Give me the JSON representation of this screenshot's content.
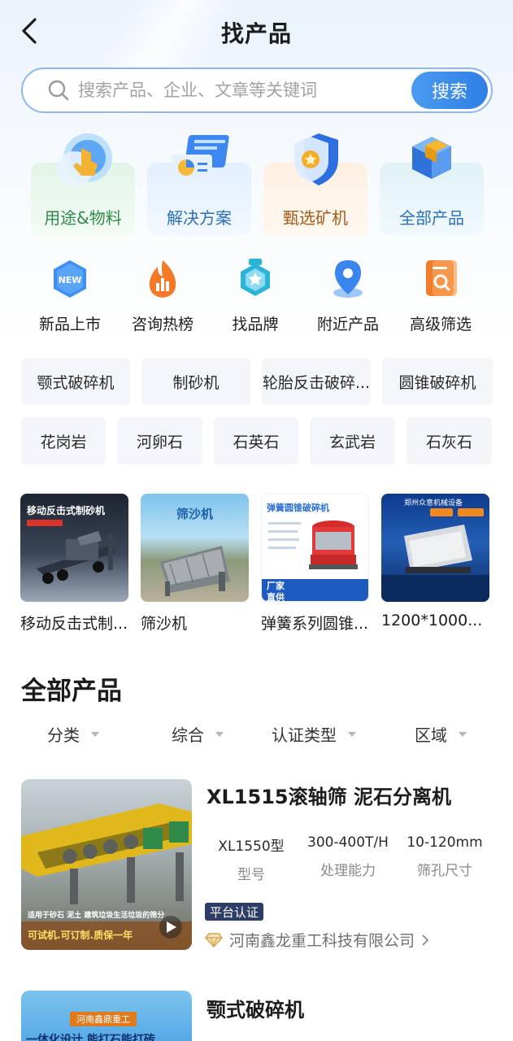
{
  "header": {
    "title": "找产品"
  },
  "search": {
    "placeholder": "搜索产品、企业、文章等关键词",
    "button": "搜索"
  },
  "categories": [
    {
      "label": "用途&物料",
      "color": "#2f8a4a"
    },
    {
      "label": "解决方案",
      "color": "#2d6fb5"
    },
    {
      "label": "甄选矿机",
      "color": "#a35a16"
    },
    {
      "label": "全部产品",
      "color": "#2a6fb8"
    }
  ],
  "quick_links": [
    {
      "label": "新品上市",
      "icon": "new-icon"
    },
    {
      "label": "咨询热榜",
      "icon": "hot-chart-icon"
    },
    {
      "label": "找品牌",
      "icon": "brand-star-icon"
    },
    {
      "label": "附近产品",
      "icon": "location-pin-icon"
    },
    {
      "label": "高级筛选",
      "icon": "filter-search-icon"
    }
  ],
  "chips_row1": [
    "颚式破碎机",
    "制砂机",
    "轮胎反击破碎...",
    "圆锥破碎机"
  ],
  "chips_row2": [
    "花岗岩",
    "河卵石",
    "石英石",
    "玄武岩",
    "石灰石"
  ],
  "featured": [
    {
      "caption": "移动反击式制...",
      "banner": "移动反击式制砂机"
    },
    {
      "caption": "筛沙机",
      "banner": "筛沙机"
    },
    {
      "caption": "弹簧系列圆锥...",
      "banner": "弹簧圆锥破碎机",
      "tag1": "厂家",
      "tag2": "直供"
    },
    {
      "caption": "1200*1000...",
      "banner": "郑州众意机械设备"
    }
  ],
  "section": {
    "title": "全部产品"
  },
  "filters": [
    "分类",
    "综合",
    "认证类型",
    "区域"
  ],
  "product1": {
    "name": "XL1515滚轴筛 泥石分离机",
    "specs": [
      {
        "value": "XL1550型",
        "label": "型号"
      },
      {
        "value": "300-400T/H",
        "label": "处理能力"
      },
      {
        "value": "10-120mm",
        "label": "筛孔尺寸"
      }
    ],
    "badge": "平台认证",
    "company": "河南鑫龙重工科技有限公司",
    "image_text1": "适用于砂石 泥土 建筑垃圾生活垃圾的筛分",
    "image_text2": "可试机.可订制.质保一年"
  },
  "product2": {
    "name": "颚式破碎机",
    "image_text1": "河南鑫鼎重工",
    "image_text2": "一体化设计 能打石能打砖"
  }
}
